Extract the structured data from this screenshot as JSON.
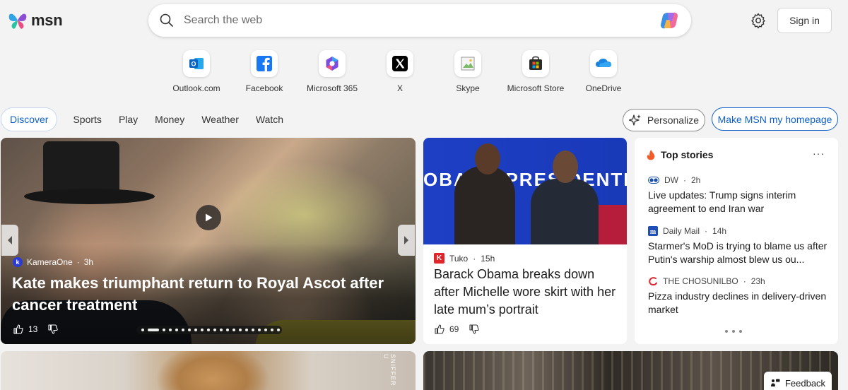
{
  "header": {
    "logo_text": "msn",
    "search_placeholder": "Search the web",
    "signin_label": "Sign in"
  },
  "quick_links": [
    {
      "label": "Outlook.com",
      "icon": "outlook-icon"
    },
    {
      "label": "Facebook",
      "icon": "facebook-icon"
    },
    {
      "label": "Microsoft 365",
      "icon": "microsoft-365-icon"
    },
    {
      "label": "X",
      "icon": "x-icon"
    },
    {
      "label": "Skype",
      "icon": "skype-icon"
    },
    {
      "label": "Microsoft Store",
      "icon": "microsoft-store-icon"
    },
    {
      "label": "OneDrive",
      "icon": "onedrive-icon"
    }
  ],
  "nav": {
    "items": [
      "Discover",
      "Sports",
      "Play",
      "Money",
      "Weather",
      "Watch"
    ],
    "personalize_label": "Personalize",
    "homepage_label": "Make MSN my homepage"
  },
  "hero": {
    "source": "KameraOne",
    "source_initial": "k",
    "time": "3h",
    "title": "Kate makes triumphant return to Royal Ascot after cancer treatment",
    "likes": "13"
  },
  "card2": {
    "banner_text": "OBAMA PRESIDENTIAL",
    "source": "Tuko",
    "source_initial": "K",
    "time": "15h",
    "title": "Barack Obama breaks down after Michelle wore skirt with her late mum’s portrait",
    "likes": "69"
  },
  "top_stories": {
    "heading": "Top stories",
    "more": "···",
    "stories": [
      {
        "source": "DW",
        "time": "2h",
        "title": "Live updates: Trump signs interim agreement to end Iran war"
      },
      {
        "source": "Daily Mail",
        "time": "14h",
        "title": "Starmer's MoD is trying to blame us after Putin's warship almost blew us ou..."
      },
      {
        "source": "THE CHOSUNILBO",
        "time": "23h",
        "title": "Pizza industry declines in delivery-driven market"
      }
    ]
  },
  "bottom": {
    "side_text": "SNIFFER U"
  },
  "feedback_label": "Feedback",
  "colors": {
    "accent": "#0f5fc7",
    "background": "#f3f3f4",
    "tuko_red": "#e0262a"
  }
}
